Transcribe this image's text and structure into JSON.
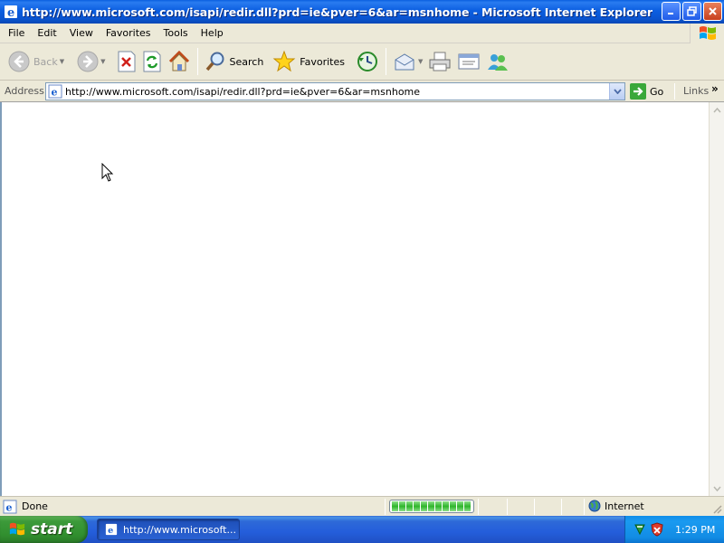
{
  "window": {
    "title": "http://www.microsoft.com/isapi/redir.dll?prd=ie&pver=6&ar=msnhome - Microsoft Internet Explorer"
  },
  "menu": {
    "items": [
      "File",
      "Edit",
      "View",
      "Favorites",
      "Tools",
      "Help"
    ]
  },
  "toolbar": {
    "back_label": "Back",
    "search_label": "Search",
    "favorites_label": "Favorites"
  },
  "address": {
    "label": "Address",
    "url": "http://www.microsoft.com/isapi/redir.dll?prd=ie&pver=6&ar=msnhome",
    "go_label": "Go",
    "links_label": "Links"
  },
  "status": {
    "text": "Done",
    "progress_percent": 100,
    "zone": "Internet"
  },
  "taskbar": {
    "start_label": "start",
    "task_label": "http://www.microsoft...",
    "clock": "1:29 PM"
  },
  "colors": {
    "titlebar": "#0a54cf",
    "chrome": "#ece9d8",
    "taskbar": "#245edb",
    "start": "#318f2f",
    "progress": "#2db52a"
  }
}
